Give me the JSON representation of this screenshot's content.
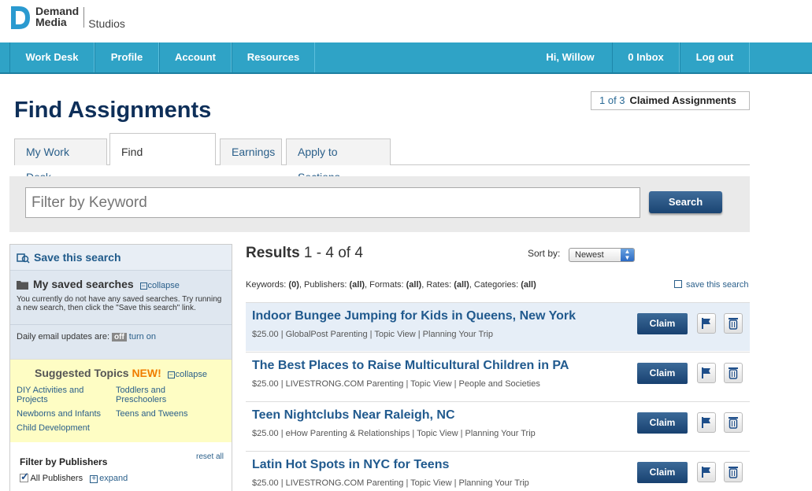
{
  "brand": {
    "name_line1": "Demand",
    "name_line2": "Media",
    "sub": "Studios"
  },
  "nav": {
    "items": [
      "Work Desk",
      "Profile",
      "Account",
      "Resources"
    ],
    "greeting": "Hi, Willow",
    "inbox": "0 Inbox",
    "logout": "Log out"
  },
  "page": {
    "title": "Find Assignments"
  },
  "claimed": {
    "count": "1 of 3",
    "label": "Claimed Assignments"
  },
  "tabs": [
    "My Work Desk",
    "Find Assignments",
    "Earnings",
    "Apply to Sections"
  ],
  "search": {
    "placeholder": "Filter by Keyword",
    "button": "Search"
  },
  "sidebar": {
    "save_search": "Save this search",
    "saved_title": "My saved searches",
    "collapse": "collapse",
    "saved_text": "You currently do not have any saved searches. Try running a new search, then click the \"Save this search\" link.",
    "daily_label": "Daily email updates are:",
    "daily_state": "off",
    "turn_on": "turn on",
    "suggested_title": "Suggested Topics",
    "suggested_new": "NEW!",
    "topics": [
      "DIY Activities and Projects",
      "Toddlers and Preschoolers",
      "Newborns and Infants",
      "Teens and Tweens",
      "Child Development"
    ],
    "filter_title": "Filter by Publishers",
    "reset_all": "reset all",
    "all_publishers": "All Publishers",
    "expand": "expand"
  },
  "results": {
    "label": "Results",
    "range": "1 - 4 of 4",
    "sort_label": "Sort by:",
    "sort_value": "Newest",
    "criteria": [
      {
        "k": "Keywords:",
        "v": "(0)"
      },
      {
        "k": "Publishers:",
        "v": "(all)"
      },
      {
        "k": "Formats:",
        "v": "(all)"
      },
      {
        "k": "Rates:",
        "v": "(all)"
      },
      {
        "k": "Categories:",
        "v": "(all)"
      }
    ],
    "save_link": "save this search",
    "claim_label": "Claim",
    "items": [
      {
        "title": "Indoor Bungee Jumping for Kids in Queens, New York",
        "meta": "$25.00 | GlobalPost Parenting | Topic View | Planning Your Trip"
      },
      {
        "title": "The Best Places to Raise Multicultural Children in PA",
        "meta": "$25.00 | LIVESTRONG.COM Parenting | Topic View | People and Societies"
      },
      {
        "title": "Teen Nightclubs Near Raleigh, NC",
        "meta": "$25.00 | eHow Parenting & Relationships | Topic View | Planning Your Trip"
      },
      {
        "title": "Latin Hot Spots in NYC for Teens",
        "meta": "$25.00 | LIVESTRONG.COM Parenting | Topic View | Planning Your Trip"
      }
    ]
  },
  "colors": {
    "nav": "#2fa3c6",
    "title": "#0e2f59",
    "link": "#215a8e",
    "button": "#1a4472",
    "new": "#f07d00"
  }
}
